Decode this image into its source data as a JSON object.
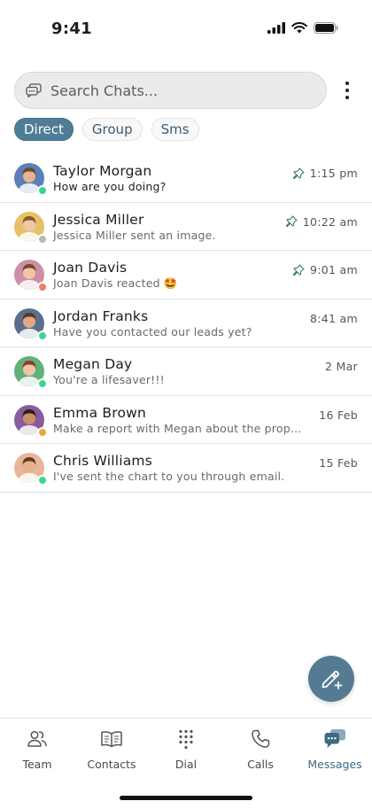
{
  "status_bar": {
    "time": "9:41"
  },
  "search": {
    "placeholder": "Search Chats..."
  },
  "filters": [
    {
      "label": "Direct",
      "active": true
    },
    {
      "label": "Group",
      "active": false
    },
    {
      "label": "Sms",
      "active": false
    }
  ],
  "chats": [
    {
      "name": "Taylor Morgan",
      "preview": "How are you doing?",
      "time": "1:15 pm",
      "pinned": true,
      "unread": true,
      "presence": "#3dd68c",
      "avatar_bg": "#5b7fb8",
      "skin": "#e8b48f",
      "hair": "#6b4a2f"
    },
    {
      "name": "Jessica Miller",
      "preview": "Jessica Miller sent an image.",
      "time": "10:22 am",
      "pinned": true,
      "unread": false,
      "presence": "#b8b8b8",
      "avatar_bg": "#e6c16a",
      "skin": "#f0c7a8",
      "hair": "#8a5a2b"
    },
    {
      "name": "Joan Davis",
      "preview": "Joan Davis reacted 🤩",
      "time": "9:01 am",
      "pinned": true,
      "unread": false,
      "presence": "#f07a6a",
      "avatar_bg": "#cc8fa8",
      "skin": "#f1c6a6",
      "hair": "#7a4a26"
    },
    {
      "name": "Jordan Franks",
      "preview": "Have you contacted our leads yet?",
      "time": "8:41 am",
      "pinned": false,
      "unread": false,
      "presence": "#3dd68c",
      "avatar_bg": "#5a6f8e",
      "skin": "#e2a883",
      "hair": "#5a3a22"
    },
    {
      "name": "Megan Day",
      "preview": "You're a lifesaver!!!",
      "time": "2 Mar",
      "pinned": false,
      "unread": false,
      "presence": "#3dd68c",
      "avatar_bg": "#62b07a",
      "skin": "#f0c5a5",
      "hair": "#8b3f2a"
    },
    {
      "name": "Emma Brown",
      "preview": "Make a report with Megan about the propo...",
      "time": "16 Feb",
      "pinned": false,
      "unread": false,
      "presence": "#e8a93a",
      "avatar_bg": "#8a5aa0",
      "skin": "#c98f6c",
      "hair": "#2e1e16"
    },
    {
      "name": "Chris Williams",
      "preview": "I've sent the chart to you through email.",
      "time": "15 Feb",
      "pinned": false,
      "unread": false,
      "presence": "#3dd68c",
      "avatar_bg": "#e8b59a",
      "skin": "#e6b08c",
      "hair": "#5e3d24"
    }
  ],
  "nav": [
    {
      "label": "Team",
      "icon": "team-icon",
      "active": false
    },
    {
      "label": "Contacts",
      "icon": "contacts-icon",
      "active": false
    },
    {
      "label": "Dial",
      "icon": "dialpad-icon",
      "active": false
    },
    {
      "label": "Calls",
      "icon": "phone-icon",
      "active": false
    },
    {
      "label": "Messages",
      "icon": "messages-icon",
      "active": true
    }
  ],
  "colors": {
    "accent": "#4f7d98",
    "fab": "#557b93",
    "active_nav": "#3f6a86"
  }
}
